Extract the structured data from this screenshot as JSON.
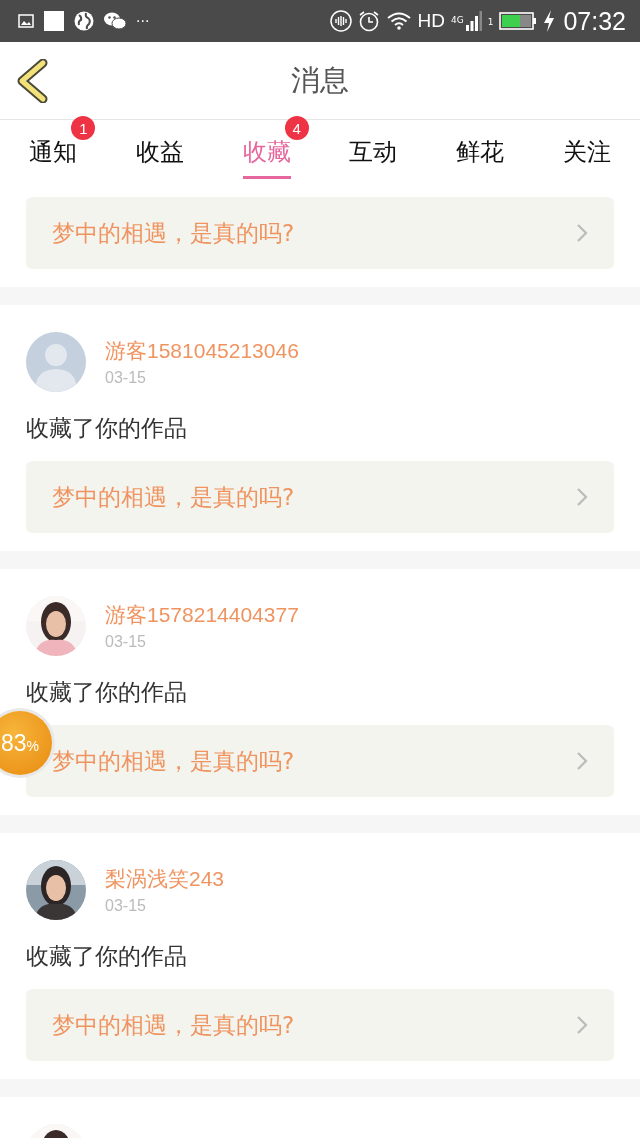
{
  "status_bar": {
    "more": "···",
    "network": "HD",
    "signal_type": "4G",
    "sim": "1",
    "time": "07:32"
  },
  "header": {
    "title": "消息"
  },
  "tabs": [
    {
      "label": "通知",
      "selected": false,
      "badge": "1"
    },
    {
      "label": "收益",
      "selected": false
    },
    {
      "label": "收藏",
      "selected": true,
      "badge": "4"
    },
    {
      "label": "互动",
      "selected": false
    },
    {
      "label": "鲜花",
      "selected": false
    },
    {
      "label": "关注",
      "selected": false
    }
  ],
  "top_item": {
    "work_title": "梦中的相遇，是真的吗?"
  },
  "items": [
    {
      "avatar": {
        "kind": "default"
      },
      "user": "游客1581045213046",
      "date": "03-15",
      "action": "收藏了你的作品",
      "work_title": "梦中的相遇，是真的吗?"
    },
    {
      "avatar": {
        "kind": "picture"
      },
      "user": "游客1578214404377",
      "date": "03-15",
      "action": "收藏了你的作品",
      "work_title": "梦中的相遇，是真的吗?"
    },
    {
      "avatar": {
        "kind": "picture"
      },
      "user": "梨涡浅笑243",
      "date": "03-15",
      "action": "收藏了你的作品",
      "work_title": "梦中的相遇，是真的吗?"
    },
    {
      "avatar": {
        "kind": "picture"
      }
    }
  ],
  "floating_badge": {
    "value": "83",
    "unit": "%"
  }
}
